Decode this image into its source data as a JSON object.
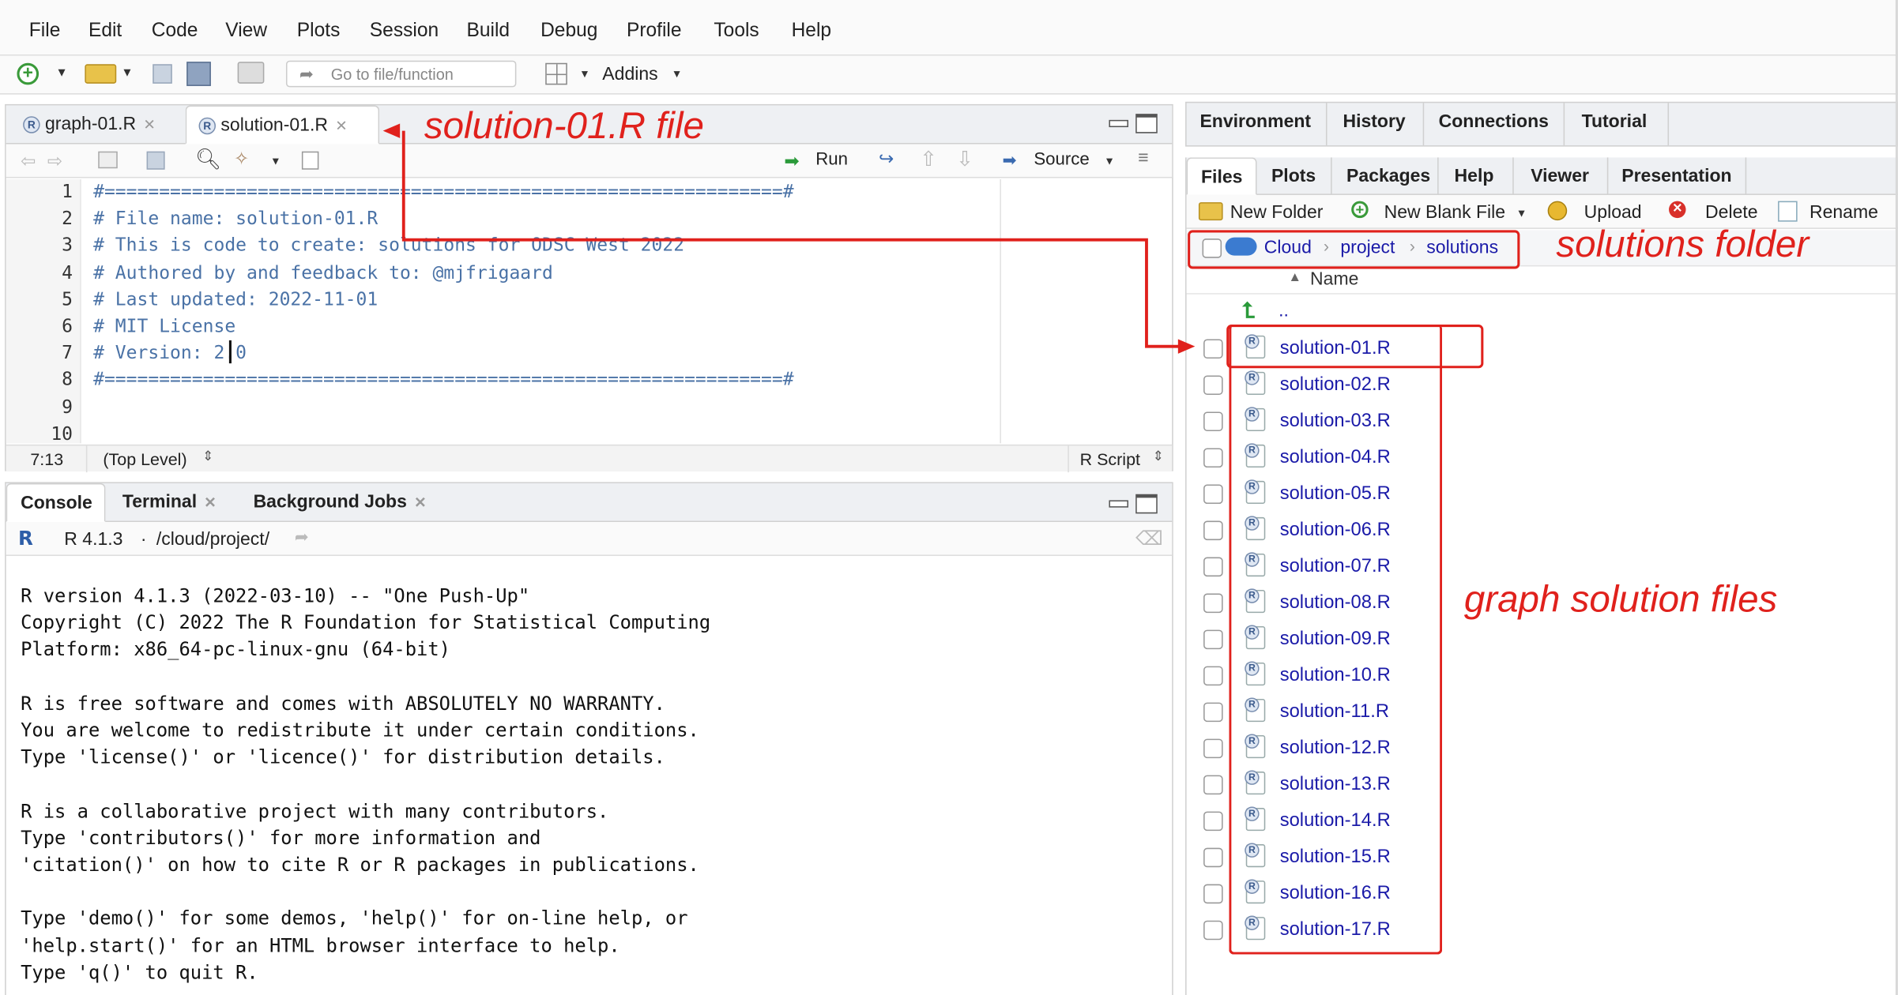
{
  "menu": [
    "File",
    "Edit",
    "Code",
    "View",
    "Plots",
    "Session",
    "Build",
    "Debug",
    "Profile",
    "Tools",
    "Help"
  ],
  "toolbar": {
    "goto_placeholder": "Go to file/function",
    "addins": "Addins"
  },
  "editor": {
    "tabs": [
      {
        "label": "graph-01.R"
      },
      {
        "label": "solution-01.R"
      }
    ],
    "run": "Run",
    "source": "Source",
    "lines": [
      "#==============================================================#",
      "# File name: solution-01.R",
      "# This is code to create: solutions for ODSC West 2022",
      "# Authored by and feedback to: @mjfrigaard",
      "# Last updated: 2022-11-01",
      "# MIT License",
      "# Version: 2.0",
      "#==============================================================#",
      "",
      ""
    ],
    "line_numbers": [
      "1",
      "2",
      "3",
      "4",
      "5",
      "6",
      "7",
      "8",
      "9",
      "10"
    ],
    "status": {
      "position": "7:13",
      "scope": "(Top Level)",
      "filetype": "R Script"
    }
  },
  "console": {
    "tabs": [
      {
        "label": "Console"
      },
      {
        "label": "Terminal"
      },
      {
        "label": "Background Jobs"
      }
    ],
    "r_version": "R 4.1.3",
    "path": "/cloud/project/",
    "lines": [
      "R version 4.1.3 (2022-03-10) -- \"One Push-Up\"",
      "Copyright (C) 2022 The R Foundation for Statistical Computing",
      "Platform: x86_64-pc-linux-gnu (64-bit)",
      "",
      "R is free software and comes with ABSOLUTELY NO WARRANTY.",
      "You are welcome to redistribute it under certain conditions.",
      "Type 'license()' or 'licence()' for distribution details.",
      "",
      "R is a collaborative project with many contributors.",
      "Type 'contributors()' for more information and",
      "'citation()' on how to cite R or R packages in publications.",
      "",
      "Type 'demo()' for some demos, 'help()' for on-line help, or",
      "'help.start()' for an HTML browser interface to help.",
      "Type 'q()' to quit R."
    ]
  },
  "env_tabs": [
    {
      "label": "Environment"
    },
    {
      "label": "History"
    },
    {
      "label": "Connections"
    },
    {
      "label": "Tutorial"
    }
  ],
  "files_tabs": [
    {
      "label": "Files"
    },
    {
      "label": "Plots"
    },
    {
      "label": "Packages"
    },
    {
      "label": "Help"
    },
    {
      "label": "Viewer"
    },
    {
      "label": "Presentation"
    }
  ],
  "files_toolbar": {
    "new_folder": "New Folder",
    "new_blank_file": "New Blank File",
    "upload": "Upload",
    "delete": "Delete",
    "rename": "Rename"
  },
  "breadcrumb": [
    "Cloud",
    "project",
    "solutions"
  ],
  "column_header": "Name",
  "parent_dir": "..",
  "files": [
    "solution-01.R",
    "solution-02.R",
    "solution-03.R",
    "solution-04.R",
    "solution-05.R",
    "solution-06.R",
    "solution-07.R",
    "solution-08.R",
    "solution-09.R",
    "solution-10.R",
    "solution-11.R",
    "solution-12.R",
    "solution-13.R",
    "solution-14.R",
    "solution-15.R",
    "solution-16.R",
    "solution-17.R"
  ],
  "annotations": {
    "file": "solution-01.R file",
    "folder": "solutions folder",
    "files": "graph solution files"
  },
  "colors": {
    "annotation": "#e0211c",
    "file_link": "#1a1aa8",
    "code_comment": "#4a72a6"
  }
}
